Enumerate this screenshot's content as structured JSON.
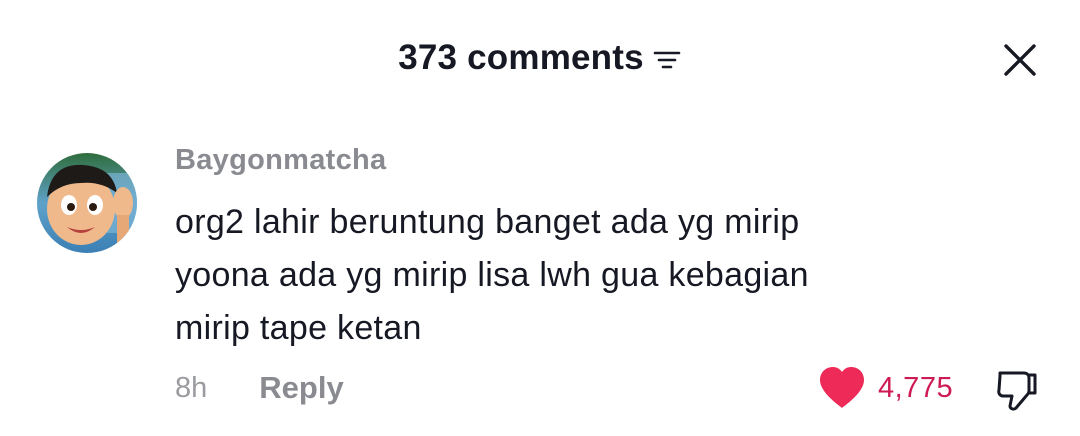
{
  "header": {
    "title": "373 comments",
    "filter_icon": "filter-lines-icon",
    "close_icon": "close-icon"
  },
  "comment": {
    "username": "Baygonmatcha",
    "text_lines": [
      "org2 lahir beruntung banget ada yg mirip",
      "yoona ada yg mirip lisa lwh gua kebagian",
      "mirip tape ketan"
    ],
    "time": "8h",
    "reply_label": "Reply",
    "like_count": "4,775",
    "like_icon": "heart-icon",
    "dislike_icon": "thumbs-down-icon"
  },
  "colors": {
    "title": "#161823",
    "username": "#8a8b91",
    "like": "#ee2b58",
    "like_count": "#ce1a53",
    "meta": "#9a9ba0"
  }
}
